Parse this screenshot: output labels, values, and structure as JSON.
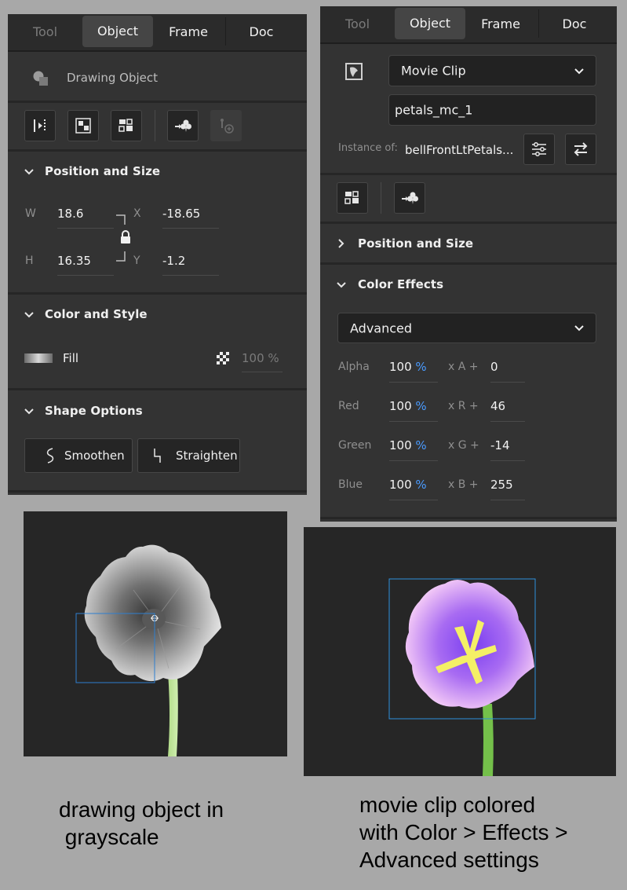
{
  "left_panel": {
    "tabs": [
      "Tool",
      "Object",
      "Frame",
      "Doc"
    ],
    "object_type": "Drawing Object",
    "position_size": {
      "title": "Position and Size",
      "w_label": "W",
      "w_value": "18.6",
      "h_label": "H",
      "h_value": "16.35",
      "x_label": "X",
      "x_value": "-18.65",
      "y_label": "Y",
      "y_value": "-1.2"
    },
    "color_style": {
      "title": "Color and Style",
      "fill_label": "Fill",
      "fill_alpha": "100 %"
    },
    "shape_options": {
      "title": "Shape Options",
      "smoothen_label": "Smoothen",
      "straighten_label": "Straighten"
    }
  },
  "right_panel": {
    "tabs": [
      "Tool",
      "Object",
      "Frame",
      "Doc"
    ],
    "symbol_type": "Movie Clip",
    "instance_name": "petals_mc_1",
    "instance_of_label": "Instance of:",
    "instance_of_value": "bellFrontLtPetals...",
    "position_size_title": "Position and Size",
    "color_effects": {
      "title": "Color Effects",
      "mode": "Advanced",
      "rows": [
        {
          "label": "Alpha",
          "percent": "100",
          "unit": "%",
          "op": "x A +",
          "offset": "0"
        },
        {
          "label": "Red",
          "percent": "100",
          "unit": "%",
          "op": "x R +",
          "offset": "46"
        },
        {
          "label": "Green",
          "percent": "100",
          "unit": "%",
          "op": "x G +",
          "offset": "-14"
        },
        {
          "label": "Blue",
          "percent": "100",
          "unit": "%",
          "op": "x B +",
          "offset": "255"
        }
      ]
    }
  },
  "captions": {
    "left": [
      "drawing object in",
      " grayscale"
    ],
    "right": [
      "movie clip colored",
      "with Color > Effects >",
      "Advanced settings"
    ]
  },
  "colors": {
    "accent_blue": "#4a9bff",
    "panel_bg": "#333333",
    "stage_bg": "#262626",
    "page_bg": "#a8a8a8"
  }
}
